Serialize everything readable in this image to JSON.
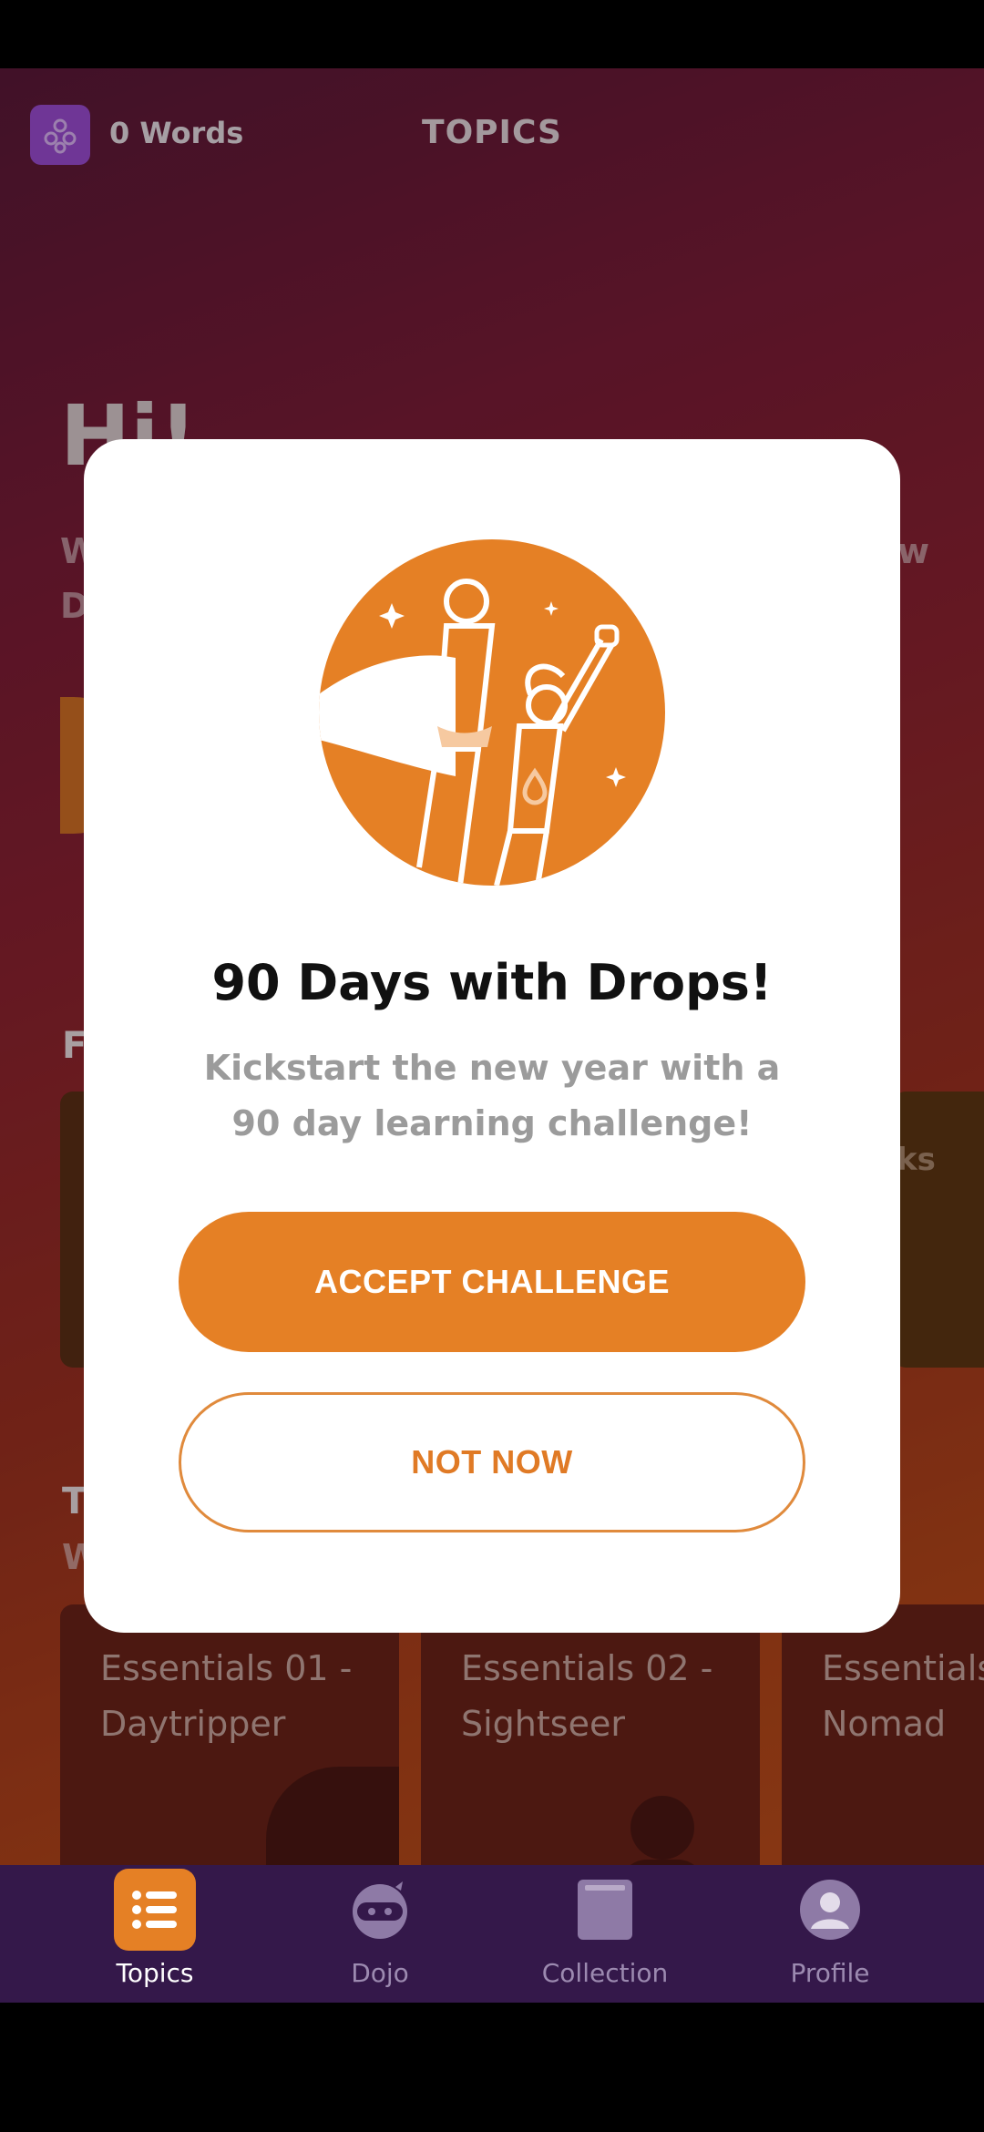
{
  "header": {
    "words_label": "0 Words",
    "title": "TOPICS"
  },
  "background": {
    "greeting": "Hi!",
    "intro_line_1_start": "W",
    "intro_line_1_end": "w",
    "intro_line_2_start": "D",
    "section_1_letter": "F",
    "section_1_card_right": "ks",
    "section_2_letter": "T",
    "section_2_sub": "W"
  },
  "topic_cards": [
    {
      "title": "Essentials 01 - Daytripper"
    },
    {
      "title": "Essentials 02 - Sightseer"
    },
    {
      "title": "Essentials Nomad"
    }
  ],
  "modal": {
    "title": "90 Days with Drops!",
    "subtitle": "Kickstart the new year with a 90 day learning challenge!",
    "accept_label": "ACCEPT CHALLENGE",
    "decline_label": "NOT NOW"
  },
  "nav": {
    "items": [
      {
        "label": "Topics",
        "icon": "topics-list-icon",
        "active": true
      },
      {
        "label": "Dojo",
        "icon": "ninja-icon",
        "active": false
      },
      {
        "label": "Collection",
        "icon": "book-icon",
        "active": false
      },
      {
        "label": "Profile",
        "icon": "person-icon",
        "active": false
      }
    ]
  },
  "colors": {
    "accent": "#e58025",
    "nav_bg": "#34184a",
    "modal_bg": "#ffffff",
    "words_badge": "#9a4bd0"
  }
}
